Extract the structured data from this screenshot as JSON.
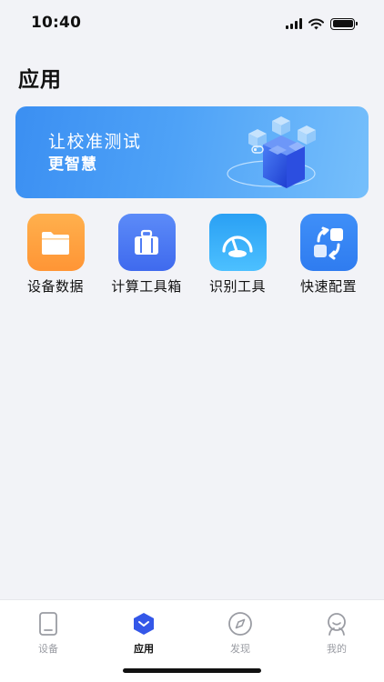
{
  "status_bar": {
    "time": "10:40",
    "icons": [
      "signal-icon",
      "wifi-icon",
      "battery-icon"
    ]
  },
  "page": {
    "title": "应用"
  },
  "banner": {
    "line1": "让校准测试",
    "line2": "更智慧",
    "gradient_colors": [
      "#3b8ff2",
      "#76bffb"
    ]
  },
  "apps": [
    {
      "label": "设备数据",
      "icon": "folder-icon",
      "color": "#ff9d3b"
    },
    {
      "label": "计算工具箱",
      "icon": "briefcase-icon",
      "color": "#4f7cf5"
    },
    {
      "label": "识别工具",
      "icon": "gauge-icon",
      "color": "#2fa4f5"
    },
    {
      "label": "快速配置",
      "icon": "quick-config-icon",
      "color": "#3b8cf6"
    }
  ],
  "tab_bar": {
    "active": "应用",
    "tabs": [
      {
        "label": "设备",
        "icon": "device-icon"
      },
      {
        "label": "应用",
        "icon": "app-hexagon-icon"
      },
      {
        "label": "发现",
        "icon": "compass-icon"
      },
      {
        "label": "我的",
        "icon": "profile-icon"
      }
    ],
    "active_color": "#3457e8"
  }
}
